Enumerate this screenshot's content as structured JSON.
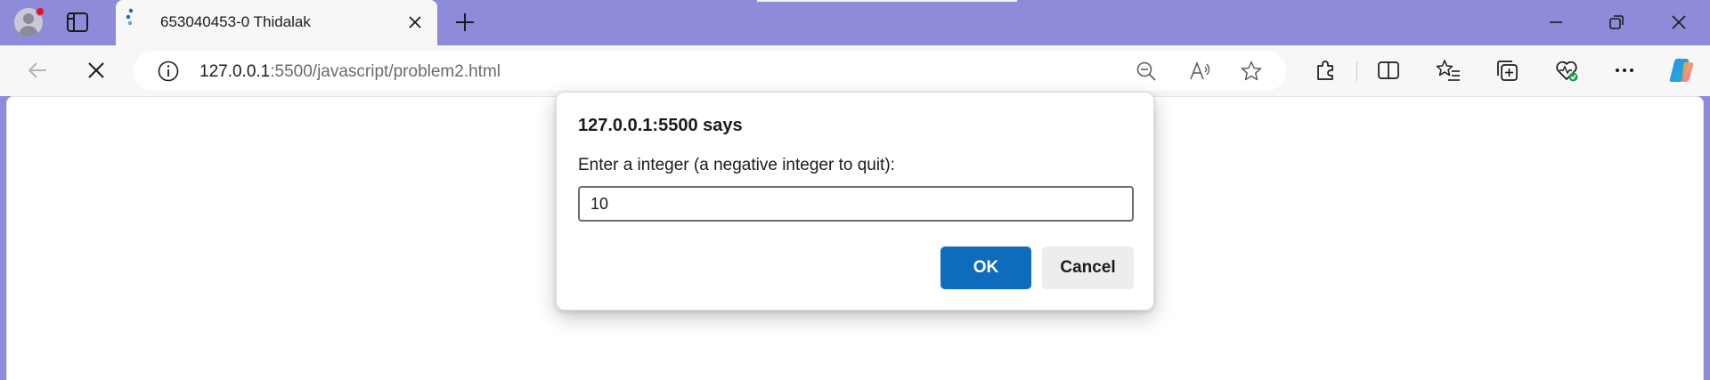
{
  "browser": {
    "tab": {
      "title": "653040453-0 Thidalak"
    },
    "address": {
      "host": "127.0.0.1",
      "rest": ":5500/javascript/problem2.html"
    },
    "icons": {
      "profile": "profile-avatar",
      "tab_actions": "tab-actions-icon",
      "favicon": "loading-favicon",
      "close_tab": "close-icon",
      "new_tab": "plus-icon",
      "minimize": "minimize-icon",
      "restore": "restore-icon",
      "close_window": "close-icon",
      "back": "back-arrow-icon",
      "stop": "stop-icon",
      "site_info": "info-icon",
      "zoom_out": "zoom-out-icon",
      "read_aloud": "read-aloud-icon",
      "favorite": "star-icon",
      "extensions": "puzzle-icon",
      "split_screen": "split-screen-icon",
      "favorites": "favorites-icon",
      "collections": "collections-icon",
      "browser_essentials": "heart-pulse-icon",
      "more": "ellipsis-icon",
      "copilot": "copilot-icon"
    },
    "colors": {
      "frame": "#8e8cd8",
      "accent": "#0f6cbd",
      "notification_dot": "#e81123"
    }
  },
  "dialog": {
    "title": "127.0.0.1:5500 says",
    "message": "Enter a integer (a negative integer to quit):",
    "input_value": "10",
    "ok_label": "OK",
    "cancel_label": "Cancel"
  }
}
